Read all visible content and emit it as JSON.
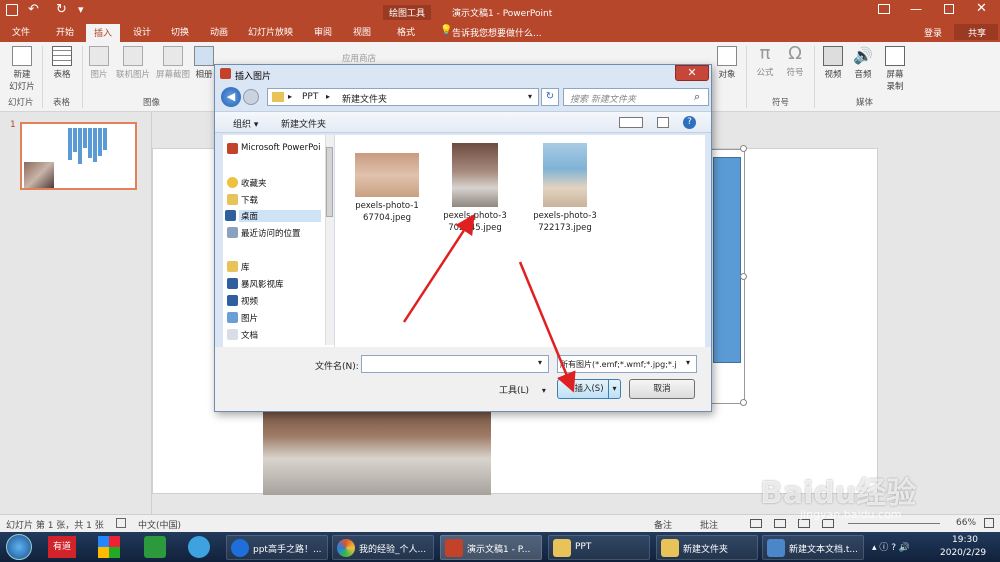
{
  "app": {
    "title": "演示文稿1 - PowerPoint",
    "context_tab": "绘图工具",
    "login": "登录",
    "share": "共享",
    "search_hint": "告诉我您想要做什么..."
  },
  "ribbon_tabs": [
    "文件",
    "开始",
    "插入",
    "设计",
    "切换",
    "动画",
    "幻灯片放映",
    "审阅",
    "视图",
    "格式"
  ],
  "ribbon": {
    "new_slide": "新建\n幻灯片",
    "table": "表格",
    "picture": "图片",
    "online_picture": "联机图片",
    "screenshot": "屏幕截图",
    "album": "相册",
    "app_store": "应用商店",
    "object": "对象",
    "formula": "公式",
    "symbol": "符号",
    "video": "视频",
    "audio": "音频",
    "screen_record": "屏幕\n录制",
    "groups": {
      "slides": "幻灯片",
      "tables": "表格",
      "images": "图像",
      "symbols": "符号",
      "media": "媒体"
    }
  },
  "thumbs": {
    "slide_number": "1"
  },
  "dialog": {
    "title": "插入图片",
    "path": [
      "PPT",
      "新建文件夹"
    ],
    "search_placeholder": "搜索 新建文件夹",
    "organize": "组织 ▾",
    "new_folder": "新建文件夹",
    "nav": [
      {
        "label": "Microsoft PowerPoi",
        "icon": "powerpoint-icon"
      },
      {
        "label": "收藏夹",
        "icon": "star-icon"
      },
      {
        "label": "下载",
        "icon": "download-icon"
      },
      {
        "label": "桌面",
        "icon": "desktop-icon",
        "selected": true
      },
      {
        "label": "最近访问的位置",
        "icon": "recent-icon"
      },
      {
        "label": "库",
        "icon": "library-icon"
      },
      {
        "label": "暴风影视库",
        "icon": "video-library-icon"
      },
      {
        "label": "视频",
        "icon": "video-icon"
      },
      {
        "label": "图片",
        "icon": "picture-icon"
      },
      {
        "label": "文档",
        "icon": "document-icon"
      }
    ],
    "files": [
      {
        "name1": "pexels-photo-1",
        "name2": "67704.jpeg"
      },
      {
        "name1": "pexels-photo-3",
        "name2": "702245.jpeg"
      },
      {
        "name1": "pexels-photo-3",
        "name2": "722173.jpeg"
      }
    ],
    "filename_label": "文件名(N):",
    "filename_value": "",
    "filetype": "所有图片(*.emf;*.wmf;*.jpg;*.j",
    "tools": "工具(L)",
    "insert": "插入(S)",
    "cancel": "取消"
  },
  "status": {
    "slide_info": "幻灯片 第 1 张，共 1 张",
    "language": "中文(中国)",
    "notes": "备注",
    "comments": "批注",
    "zoom": "66%"
  },
  "taskbar": {
    "items": [
      {
        "label": "ppt高手之路！...",
        "color": "#1e6fd9"
      },
      {
        "label": "我的经验_个人...",
        "color": "#e0562a"
      },
      {
        "label": "演示文稿1 - P...",
        "color": "#c4412a"
      },
      {
        "label": "PPT",
        "color": "#e8c35a"
      },
      {
        "label": "新建文件夹",
        "color": "#e8c35a"
      },
      {
        "label": "新建文本文档.t...",
        "color": "#4a86c8"
      }
    ],
    "time": "19:30",
    "date": "2020/2/29",
    "youdao": "有道"
  },
  "watermark": "Baidu经验",
  "watermark_url": "jingyan.baidu.com",
  "colors": {
    "accent": "#b7472a",
    "shape": "#5b9bd5",
    "arrow": "#e02020"
  }
}
